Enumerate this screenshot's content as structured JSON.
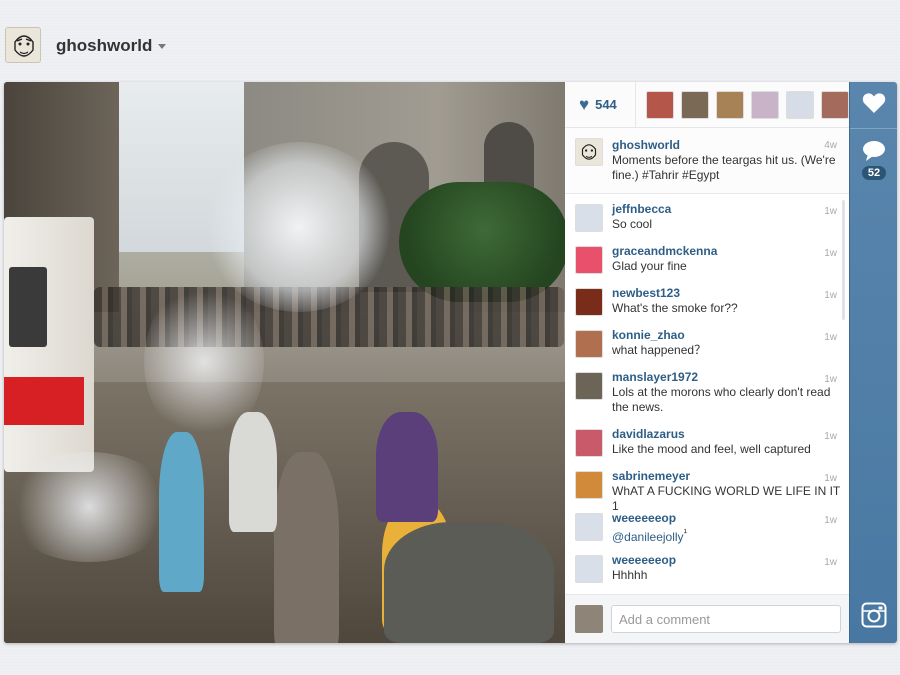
{
  "header": {
    "username": "ghoshworld",
    "avatar_icon": "profile-sketch-icon"
  },
  "post": {
    "likes_count": "544",
    "comments_count": "52",
    "likers": [
      {
        "color": "#b5564a"
      },
      {
        "color": "#7a6a55"
      },
      {
        "color": "#a88257"
      },
      {
        "color": "#c9b3c8"
      },
      {
        "color": "#d6dde7"
      },
      {
        "color": "#a46b5d"
      }
    ],
    "caption": {
      "user": "ghoshworld",
      "text": "Moments before the teargas hit us. (We're fine.) #Tahrir #Egypt",
      "time": "4w"
    },
    "comments": [
      {
        "user": "jeffnbecca",
        "text": "So cool",
        "time": "1w",
        "avatar_color": "#d9dfe8"
      },
      {
        "user": "graceandmckenna",
        "text": "Glad your fine",
        "time": "1w",
        "avatar_color": "#e9506b"
      },
      {
        "user": "newbest123",
        "text": "What's the smoke for??",
        "time": "1w",
        "avatar_color": "#7a2c1a"
      },
      {
        "user": "konnie_zhao",
        "text": "what happened？",
        "time": "1w",
        "avatar_color": "#b07050"
      },
      {
        "user": "manslayer1972",
        "text": "Lols at the morons who clearly don't read the news.",
        "time": "1w",
        "avatar_color": "#6b6457"
      },
      {
        "user": "davidlazarus",
        "text": "Like the mood and feel, well captured",
        "time": "1w",
        "avatar_color": "#c85a6a"
      },
      {
        "user": "sabrinemeyer",
        "text": "WhAT A FUCKING WORLD WE LIFE IN IT 1",
        "time": "1w",
        "avatar_color": "#d18a3a"
      },
      {
        "user": "weeeeeeop",
        "text": "@danileejolly",
        "text_suffix": "¹",
        "time": "1w",
        "avatar_color": "#d9dfe8"
      },
      {
        "user": "weeeeeeop",
        "text": "Hhhhh",
        "time": "1w",
        "avatar_color": "#d9dfe8"
      }
    ],
    "comment_input": {
      "placeholder": "Add a comment",
      "value": ""
    }
  },
  "icons": {
    "like": "heart-icon",
    "comment": "speech-bubble-icon",
    "instagram": "instagram-camera-icon"
  }
}
